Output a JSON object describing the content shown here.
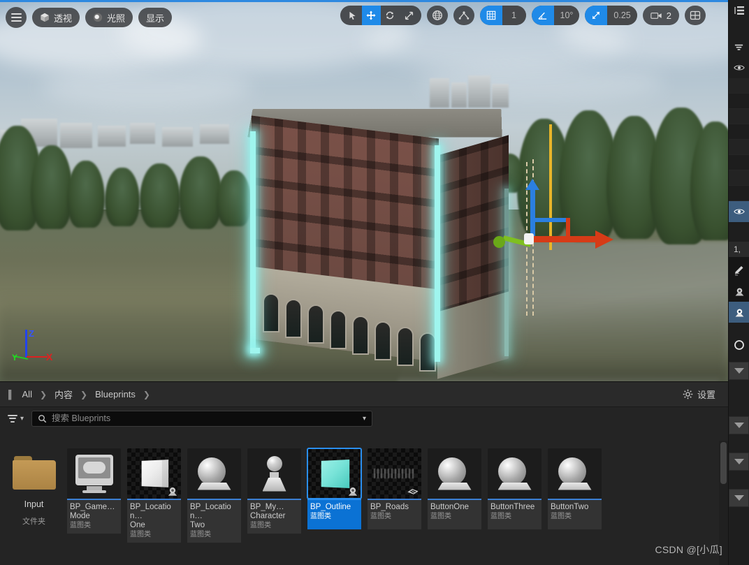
{
  "viewport": {
    "toolbar_left": [
      {
        "name": "menu",
        "label": "",
        "icon": "hamburger-icon"
      },
      {
        "name": "perspective",
        "label": "透视",
        "icon": "cube-icon"
      },
      {
        "name": "lighting",
        "label": "光照",
        "icon": "moon-icon"
      },
      {
        "name": "show",
        "label": "显示",
        "icon": ""
      }
    ],
    "toolbar_right": {
      "transform_modes": [
        {
          "name": "select",
          "icon": "cursor-arrow-icon",
          "active": false
        },
        {
          "name": "translate",
          "icon": "move-icon",
          "active": true
        },
        {
          "name": "rotate",
          "icon": "rotate-icon",
          "active": false
        },
        {
          "name": "scale",
          "icon": "scale-icon",
          "active": false
        }
      ],
      "coordinate_system": {
        "name": "world-space",
        "icon": "globe-icon",
        "active": false
      },
      "surface_snap": {
        "name": "surface-snap",
        "icon": "surface-snap-icon",
        "active": false
      },
      "grid_snap": {
        "icon": "grid-icon",
        "active": true,
        "value": "1"
      },
      "angle_snap": {
        "icon": "angle-icon",
        "active": true,
        "value": "10°"
      },
      "scale_snap": {
        "icon": "scale-snap-icon",
        "active": true,
        "value": "0.25"
      },
      "camera_speed": {
        "icon": "camera-icon",
        "value": "2"
      },
      "viewport_layout": {
        "icon": "layout-grid-icon"
      }
    },
    "axis_indicator": {
      "x": "X",
      "y": "Y",
      "z": "Z"
    },
    "gizmo": "translate-gizmo"
  },
  "content_browser": {
    "breadcrumb": [
      {
        "label": "All"
      },
      {
        "label": "内容"
      },
      {
        "label": "Blueprints"
      }
    ],
    "settings": {
      "label": "设置",
      "icon": "gear-icon"
    },
    "search": {
      "placeholder": "搜索 Blueprints",
      "value": "",
      "icon": "search-icon",
      "filter_icon": "filter-icon",
      "chevron_icon": "chevron-down-icon"
    },
    "folders": [
      {
        "name": "Input",
        "type": "文件夹",
        "icon": "folder-icon"
      }
    ],
    "assets": [
      {
        "name": "BP_Game…",
        "name2": "Mode",
        "type": "蓝图类",
        "thumb": "gamepad-monitor",
        "selected": false
      },
      {
        "name": "BP_Location…",
        "name2": "One",
        "type": "蓝图类",
        "thumb": "white-cube",
        "selected": false
      },
      {
        "name": "BP_Location…",
        "name2": "Two",
        "type": "蓝图类",
        "thumb": "sphere-plinth",
        "selected": false
      },
      {
        "name": "BP_My…",
        "name2": "Character",
        "type": "蓝图类",
        "thumb": "pawn",
        "selected": false
      },
      {
        "name": "BP_Outline",
        "name2": "",
        "type": "蓝图类",
        "thumb": "cyan-cube",
        "selected": true
      },
      {
        "name": "BP_Roads",
        "name2": "",
        "type": "蓝图类",
        "thumb": "road-spray",
        "selected": false
      },
      {
        "name": "ButtonOne",
        "name2": "",
        "type": "蓝图类",
        "thumb": "sphere-plinth",
        "selected": false
      },
      {
        "name": "ButtonThree",
        "name2": "",
        "type": "蓝图类",
        "thumb": "sphere-plinth",
        "selected": false
      },
      {
        "name": "ButtonTwo",
        "name2": "",
        "type": "蓝图类",
        "thumb": "sphere-plinth",
        "selected": false
      }
    ]
  },
  "right_dock": {
    "buttons": [
      {
        "name": "outliner",
        "icon": "outliner-icon"
      },
      {
        "name": "filter",
        "icon": "filter-icon"
      },
      {
        "name": "visibility-top",
        "icon": "eye-icon",
        "active": false
      },
      {
        "name": "visibility-selected",
        "icon": "eye-icon",
        "active": true
      },
      {
        "name": "edit",
        "icon": "pencil-icon"
      },
      {
        "name": "detail-1",
        "icon": "detail-icon",
        "active": false
      },
      {
        "name": "detail-2",
        "icon": "detail-icon",
        "active": true
      },
      {
        "name": "search-round",
        "icon": "search-icon"
      }
    ],
    "value_text": "1,"
  },
  "watermark": "CSDN @[小瓜]",
  "colors": {
    "accent_blue": "#1f8ae8",
    "selection_blue": "#0b72d4",
    "tile_accent": "#3b7fd4",
    "outline_cyan": "#9ff5ee",
    "gizmo_x": "#d63b17",
    "gizmo_y": "#7fbf20",
    "gizmo_z": "#2b7fe0",
    "panel_bg": "#242424"
  }
}
